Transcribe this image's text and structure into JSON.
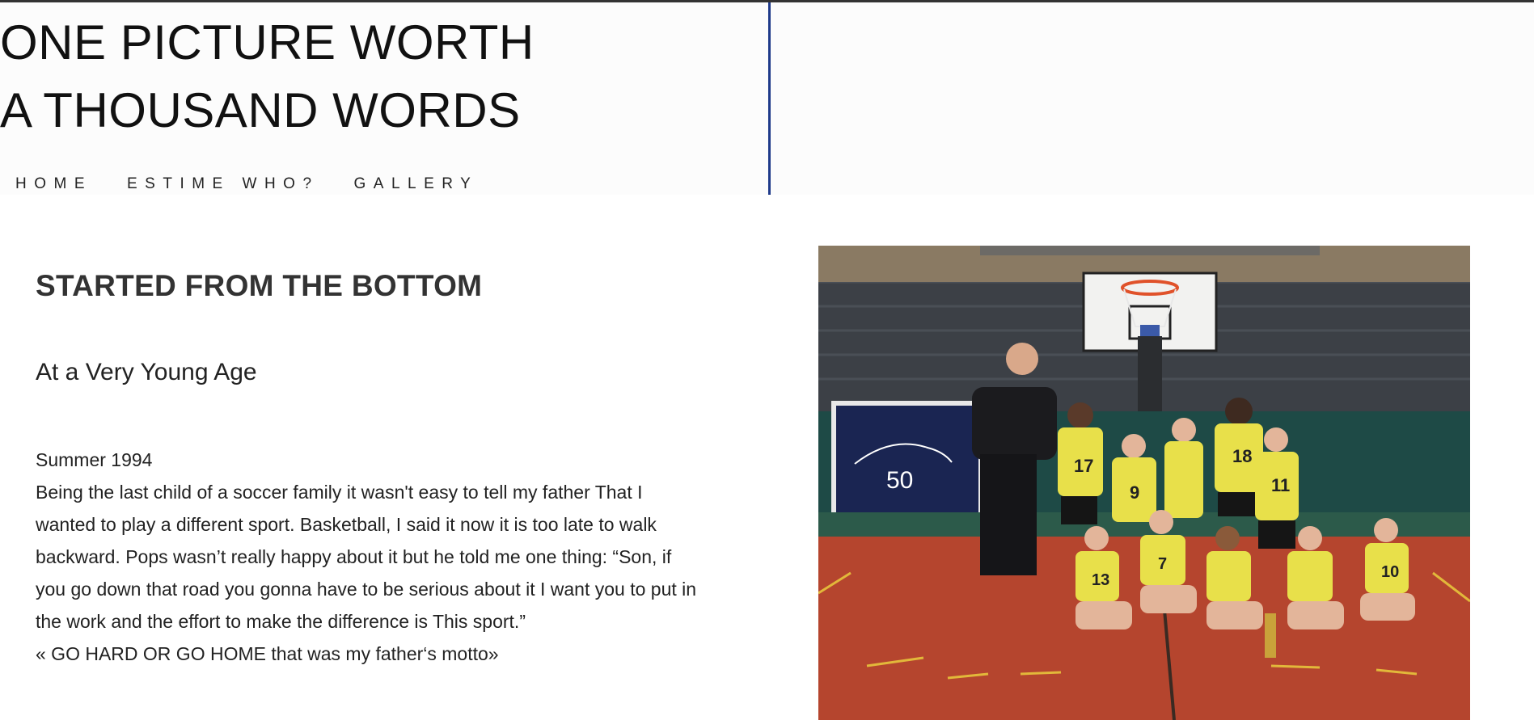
{
  "site": {
    "title_line1": "ONE PICTURE WORTH",
    "title_line2": "A THOUSAND WORDS"
  },
  "nav": {
    "items": [
      {
        "label": "HOME"
      },
      {
        "label": "ESTIME WHO?"
      },
      {
        "label": "GALLERY"
      }
    ]
  },
  "article": {
    "heading": "STARTED FROM THE BOTTOM",
    "subheading": "At a Very Young Age",
    "date": "Summer 1994",
    "paragraph": "Being the last child of a soccer family it wasn't easy to tell my father That I wanted to play a different sport. Basketball, I said it now it is too late to walk backward. Pops wasn’t really happy about it but he told me one thing: “Son, if you go down that road you gonna have to be serious about it I want you to put in the work and the effort to make the difference is This sport.”",
    "motto": "« GO HARD OR GO HOME that was my father‘s motto»"
  },
  "photo": {
    "banner_number": "50",
    "jersey_numbers": [
      "17",
      "9",
      "18",
      "11",
      "13",
      "7",
      "10"
    ]
  },
  "colors": {
    "accent_line": "#1f3a8a",
    "jersey_yellow": "#e8e04a",
    "court_red": "#b5452e"
  }
}
